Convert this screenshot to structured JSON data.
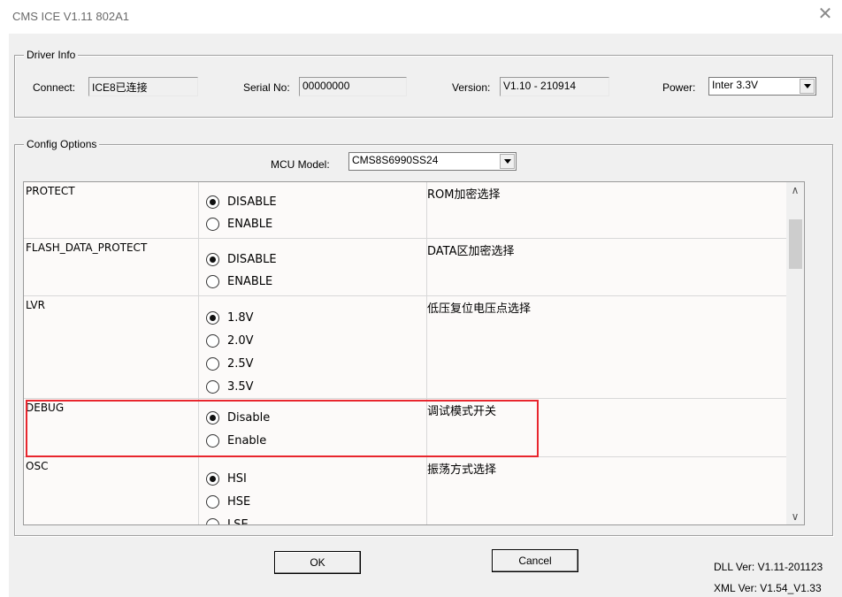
{
  "window": {
    "title": "CMS ICE V1.11 802A1",
    "close_glyph": "✕"
  },
  "driver_info": {
    "legend": "Driver Info",
    "connect_label": "Connect:",
    "connect_value": "ICE8已连接",
    "serial_label": "Serial No:",
    "serial_value": "00000000",
    "version_label": "Version:",
    "version_value": "V1.10 - 210914",
    "power_label": "Power:",
    "power_value": "Inter 3.3V"
  },
  "config": {
    "legend": "Config Options",
    "mcu_label": "MCU Model:",
    "mcu_value": "CMS8S6990SS24",
    "rows": [
      {
        "name": "PROTECT",
        "desc": "ROM加密选择",
        "options": [
          "DISABLE",
          "ENABLE"
        ],
        "selected": 0
      },
      {
        "name": "FLASH_DATA_PROTECT",
        "desc": "DATA区加密选择",
        "options": [
          "DISABLE",
          "ENABLE"
        ],
        "selected": 0
      },
      {
        "name": "LVR",
        "desc": "低压复位电压点选择",
        "options": [
          "1.8V",
          "2.0V",
          "2.5V",
          "3.5V"
        ],
        "selected": 0
      },
      {
        "name": "DEBUG",
        "desc": "调试模式开关",
        "options": [
          "Disable",
          "Enable"
        ],
        "selected": 0
      },
      {
        "name": "OSC",
        "desc": "振荡方式选择",
        "options": [
          "HSI",
          "HSE",
          "LSE"
        ],
        "selected": 0
      }
    ]
  },
  "buttons": {
    "ok": "OK",
    "cancel": "Cancel"
  },
  "footer": {
    "dll_ver": "DLL Ver: V1.11-201123",
    "xml_ver": "XML Ver:  V1.54_V1.33"
  },
  "colors": {
    "highlight": "#e8262e",
    "dialog_bg": "#f0f0f0"
  },
  "icons": {
    "scroll_up": "chevron-up-icon",
    "scroll_down": "chevron-down-icon"
  }
}
